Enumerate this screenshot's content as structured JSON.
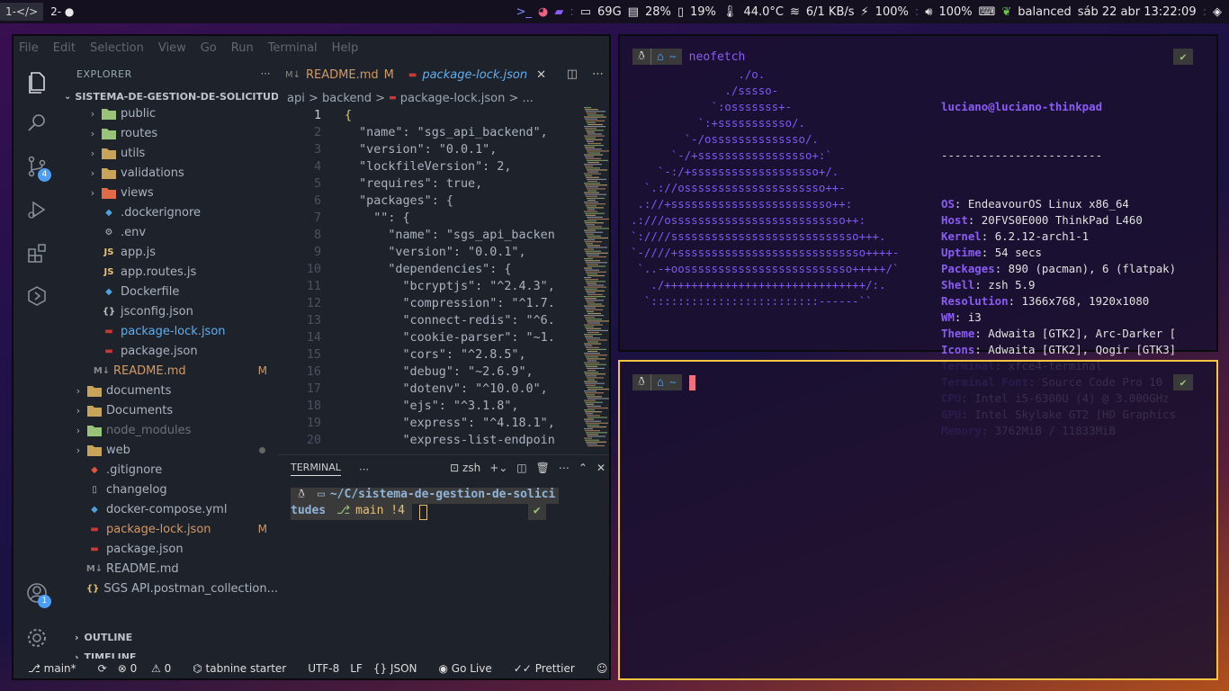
{
  "topbar": {
    "workspaces": [
      "1-</>",
      "2-"
    ],
    "disk": "69G",
    "mem": "28%",
    "swap": "19%",
    "temp": "44.0°C",
    "net": "6/1 KB/s",
    "battery": "100%",
    "volume": "100%",
    "power_profile": "balanced",
    "clock": "sáb 22 abr 13:22:09"
  },
  "vscode": {
    "menu": [
      "File",
      "Edit",
      "Selection",
      "View",
      "Go",
      "Run",
      "Terminal",
      "Help"
    ],
    "scm_badge": "4",
    "account_badge": "1",
    "explorer_title": "EXPLORER",
    "folder_name": "SISTEMA-DE-GESTION-DE-SOLICITUDES",
    "tree": [
      {
        "label": "public",
        "type": "folder",
        "depth": 1,
        "icon_color": "#98c379"
      },
      {
        "label": "routes",
        "type": "folder",
        "depth": 1,
        "icon_color": "#98c379"
      },
      {
        "label": "utils",
        "type": "folder",
        "depth": 1,
        "icon_color": "#c8a45a"
      },
      {
        "label": "validations",
        "type": "folder",
        "depth": 1,
        "icon_color": "#c8a45a"
      },
      {
        "label": "views",
        "type": "folder",
        "depth": 1,
        "icon_color": "#e06c47"
      },
      {
        "label": ".dockerignore",
        "type": "file",
        "depth": 1,
        "icon": "docker"
      },
      {
        "label": ".env",
        "type": "file",
        "depth": 1,
        "icon": "gear"
      },
      {
        "label": "app.js",
        "type": "file",
        "depth": 1,
        "icon": "js"
      },
      {
        "label": "app.routes.js",
        "type": "file",
        "depth": 1,
        "icon": "js"
      },
      {
        "label": "Dockerfile",
        "type": "file",
        "depth": 1,
        "icon": "docker"
      },
      {
        "label": "jsconfig.json",
        "type": "file",
        "depth": 1,
        "icon": "json"
      },
      {
        "label": "package-lock.json",
        "type": "file",
        "depth": 1,
        "icon": "npm",
        "active": true
      },
      {
        "label": "package.json",
        "type": "file",
        "depth": 1,
        "icon": "npm"
      },
      {
        "label": "README.md",
        "type": "file",
        "depth": 0.5,
        "icon": "md",
        "badge": "M",
        "modified": true
      },
      {
        "label": "documents",
        "type": "folder",
        "depth": 0,
        "icon_color": "#c8a45a"
      },
      {
        "label": "Documents",
        "type": "folder",
        "depth": 0,
        "icon_color": "#c8a45a"
      },
      {
        "label": "node_modules",
        "type": "folder",
        "depth": 0,
        "icon_color": "#98c379",
        "dim": true
      },
      {
        "label": "web",
        "type": "folder",
        "depth": 0,
        "icon_color": "#c8a45a",
        "dot": true
      },
      {
        "label": ".gitignore",
        "type": "file",
        "depth": 0,
        "icon": "git"
      },
      {
        "label": "changelog",
        "type": "file",
        "depth": 0,
        "icon": "doc"
      },
      {
        "label": "docker-compose.yml",
        "type": "file",
        "depth": 0,
        "icon": "docker"
      },
      {
        "label": "package-lock.json",
        "type": "file",
        "depth": 0,
        "icon": "npm",
        "badge": "M",
        "modified": true
      },
      {
        "label": "package.json",
        "type": "file",
        "depth": 0,
        "icon": "npm"
      },
      {
        "label": "README.md",
        "type": "file",
        "depth": 0,
        "icon": "md"
      },
      {
        "label": "SGS API.postman_collection...",
        "type": "file",
        "depth": 0,
        "icon": "braces"
      }
    ],
    "outline": "OUTLINE",
    "timeline": "TIMELINE",
    "tabs": [
      {
        "label": "README.md",
        "badge": "M"
      },
      {
        "label": "package-lock.json",
        "active": true
      }
    ],
    "breadcrumb": [
      "api",
      ">",
      "backend",
      ">",
      "package-lock.json",
      ">",
      "..."
    ],
    "code_lines": [
      {
        "n": "1",
        "t": "{"
      },
      {
        "n": "2",
        "t": "  \"name\": \"sgs_api_backend\","
      },
      {
        "n": "3",
        "t": "  \"version\": \"0.0.1\","
      },
      {
        "n": "4",
        "t": "  \"lockfileVersion\": 2,"
      },
      {
        "n": "5",
        "t": "  \"requires\": true,"
      },
      {
        "n": "6",
        "t": "  \"packages\": {"
      },
      {
        "n": "7",
        "t": "    \"\": {"
      },
      {
        "n": "8",
        "t": "      \"name\": \"sgs_api_backen"
      },
      {
        "n": "9",
        "t": "      \"version\": \"0.0.1\","
      },
      {
        "n": "10",
        "t": "      \"dependencies\": {"
      },
      {
        "n": "11",
        "t": "        \"bcryptjs\": \"^2.4.3\","
      },
      {
        "n": "12",
        "t": "        \"compression\": \"^1.7."
      },
      {
        "n": "13",
        "t": "        \"connect-redis\": \"^6."
      },
      {
        "n": "14",
        "t": "        \"cookie-parser\": \"~1."
      },
      {
        "n": "15",
        "t": "        \"cors\": \"^2.8.5\","
      },
      {
        "n": "16",
        "t": "        \"debug\": \"~2.6.9\","
      },
      {
        "n": "17",
        "t": "        \"dotenv\": \"^10.0.0\","
      },
      {
        "n": "18",
        "t": "        \"ejs\": \"^3.1.8\","
      },
      {
        "n": "19",
        "t": "        \"express\": \"^4.18.1\","
      },
      {
        "n": "20",
        "t": "        \"express-list-endpoin"
      }
    ],
    "panel_title": "TERMINAL",
    "shell": "zsh",
    "term_path1": "~/C/sistema-de-gestion-de-solici",
    "term_path2": "tudes",
    "term_git": "main !4",
    "term_check": "✔",
    "status": {
      "branch": "main*",
      "errors": "0",
      "warnings": "0",
      "tabnine": "tabnine starter",
      "encoding": "UTF-8",
      "eol": "LF",
      "lang": "JSON",
      "golive": "Go Live",
      "prettier": "Prettier"
    }
  },
  "term1": {
    "prompt_home": "~",
    "command": "neofetch",
    "check": "✔",
    "art": "                ./o.\n              ./sssso-\n            `:osssssss+-\n          `:+sssssssssso/.\n        `-/ossssssssssssso/.\n      `-/+sssssssssssssssso+:`\n    `-:/+sssssssssssssssssso+/.\n  `.://osssssssssssssssssssso++-\n .://+ssssssssssssssssssssssso++:\n.:///ossssssssssssssssssssssssso++:\n`:////ssssssssssssssssssssssssssso+++.\n`-////+ssssssssssssssssssssssssssso++++-\n `..-+oosssssssssssssssssssssssso+++++/`\n   ./++++++++++++++++++++++++++++++/:.\n  `:::::::::::::::::::::::::------``",
    "user_host": "luciano@luciano-thinkpad",
    "divider": "------------------------",
    "info": [
      {
        "label": "OS",
        "value": "EndeavourOS Linux x86_64"
      },
      {
        "label": "Host",
        "value": "20FVS0E000 ThinkPad L460"
      },
      {
        "label": "Kernel",
        "value": "6.2.12-arch1-1"
      },
      {
        "label": "Uptime",
        "value": "54 secs"
      },
      {
        "label": "Packages",
        "value": "890 (pacman), 6 (flatpak)"
      },
      {
        "label": "Shell",
        "value": "zsh 5.9"
      },
      {
        "label": "Resolution",
        "value": "1366x768, 1920x1080"
      },
      {
        "label": "WM",
        "value": "i3"
      },
      {
        "label": "Theme",
        "value": "Adwaita [GTK2], Arc-Darker ["
      },
      {
        "label": "Icons",
        "value": "Adwaita [GTK2], Qogir [GTK3]"
      },
      {
        "label": "Terminal",
        "value": "xfce4-terminal"
      },
      {
        "label": "Terminal Font",
        "value": "Source Code Pro 10"
      },
      {
        "label": "CPU",
        "value": "Intel i5-6300U (4) @ 3.000GHz"
      },
      {
        "label": "GPU",
        "value": "Intel Skylake GT2 [HD Graphics"
      },
      {
        "label": "Memory",
        "value": "3762MiB / 11833MiB"
      }
    ]
  },
  "term2": {
    "prompt_home": "~",
    "check": "✔"
  }
}
